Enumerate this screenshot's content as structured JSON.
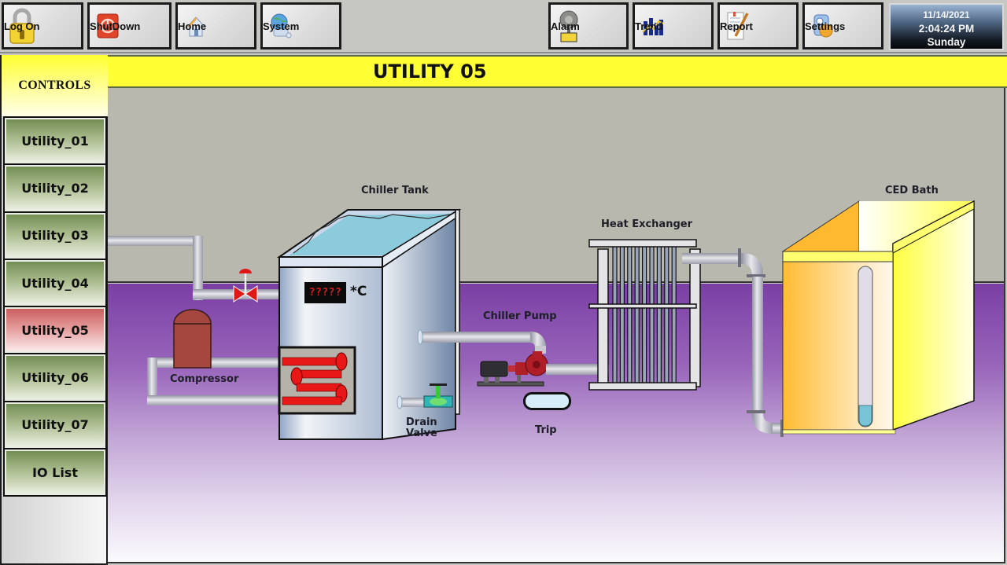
{
  "toolbar": {
    "buttons": [
      {
        "label": "Log On",
        "icon": "padlock-icon"
      },
      {
        "label": "ShutDown",
        "icon": "power-icon"
      },
      {
        "label": "Home",
        "icon": "house-icon"
      },
      {
        "label": "System",
        "icon": "globe-network-icon"
      },
      {
        "label": "Alarm",
        "icon": "bell-icon"
      },
      {
        "label": "Trend",
        "icon": "bar-chart-icon"
      },
      {
        "label": "Report",
        "icon": "document-pencil-icon"
      },
      {
        "label": "Settings",
        "icon": "settings-wrench-icon"
      }
    ],
    "clock": {
      "date": "11/14/2021",
      "time": "2:04:24 PM",
      "day": "Sunday"
    }
  },
  "sidebar": {
    "header": "CONTROLS",
    "items": [
      {
        "label": "Utility_01",
        "active": false
      },
      {
        "label": "Utility_02",
        "active": false
      },
      {
        "label": "Utility_03",
        "active": false
      },
      {
        "label": "Utility_04",
        "active": false
      },
      {
        "label": "Utility_05",
        "active": true
      },
      {
        "label": "Utility_06",
        "active": false
      },
      {
        "label": "Utility_07",
        "active": false
      },
      {
        "label": "IO List",
        "active": false
      }
    ]
  },
  "page": {
    "title": "UTILITY 05"
  },
  "process": {
    "labels": {
      "chiller_tank": "Chiller Tank",
      "compressor": "Compressor",
      "drain_valve_line1": "Drain",
      "drain_valve_line2": "Valve",
      "chiller_pump": "Chiller Pump",
      "trip": "Trip",
      "heat_exchanger": "Heat Exchanger",
      "ced_bath": "CED Bath"
    },
    "tank_temperature": {
      "value": "?????",
      "unit": "*C"
    },
    "colors": {
      "title_bar": "#ffff33",
      "active_nav": "#d26a6a",
      "nav": "#7f9a5e",
      "water": "#8ccbdb",
      "coil": "#e81818",
      "floor": "#7a3fa4",
      "ced_bath": "#ffd24a"
    }
  }
}
